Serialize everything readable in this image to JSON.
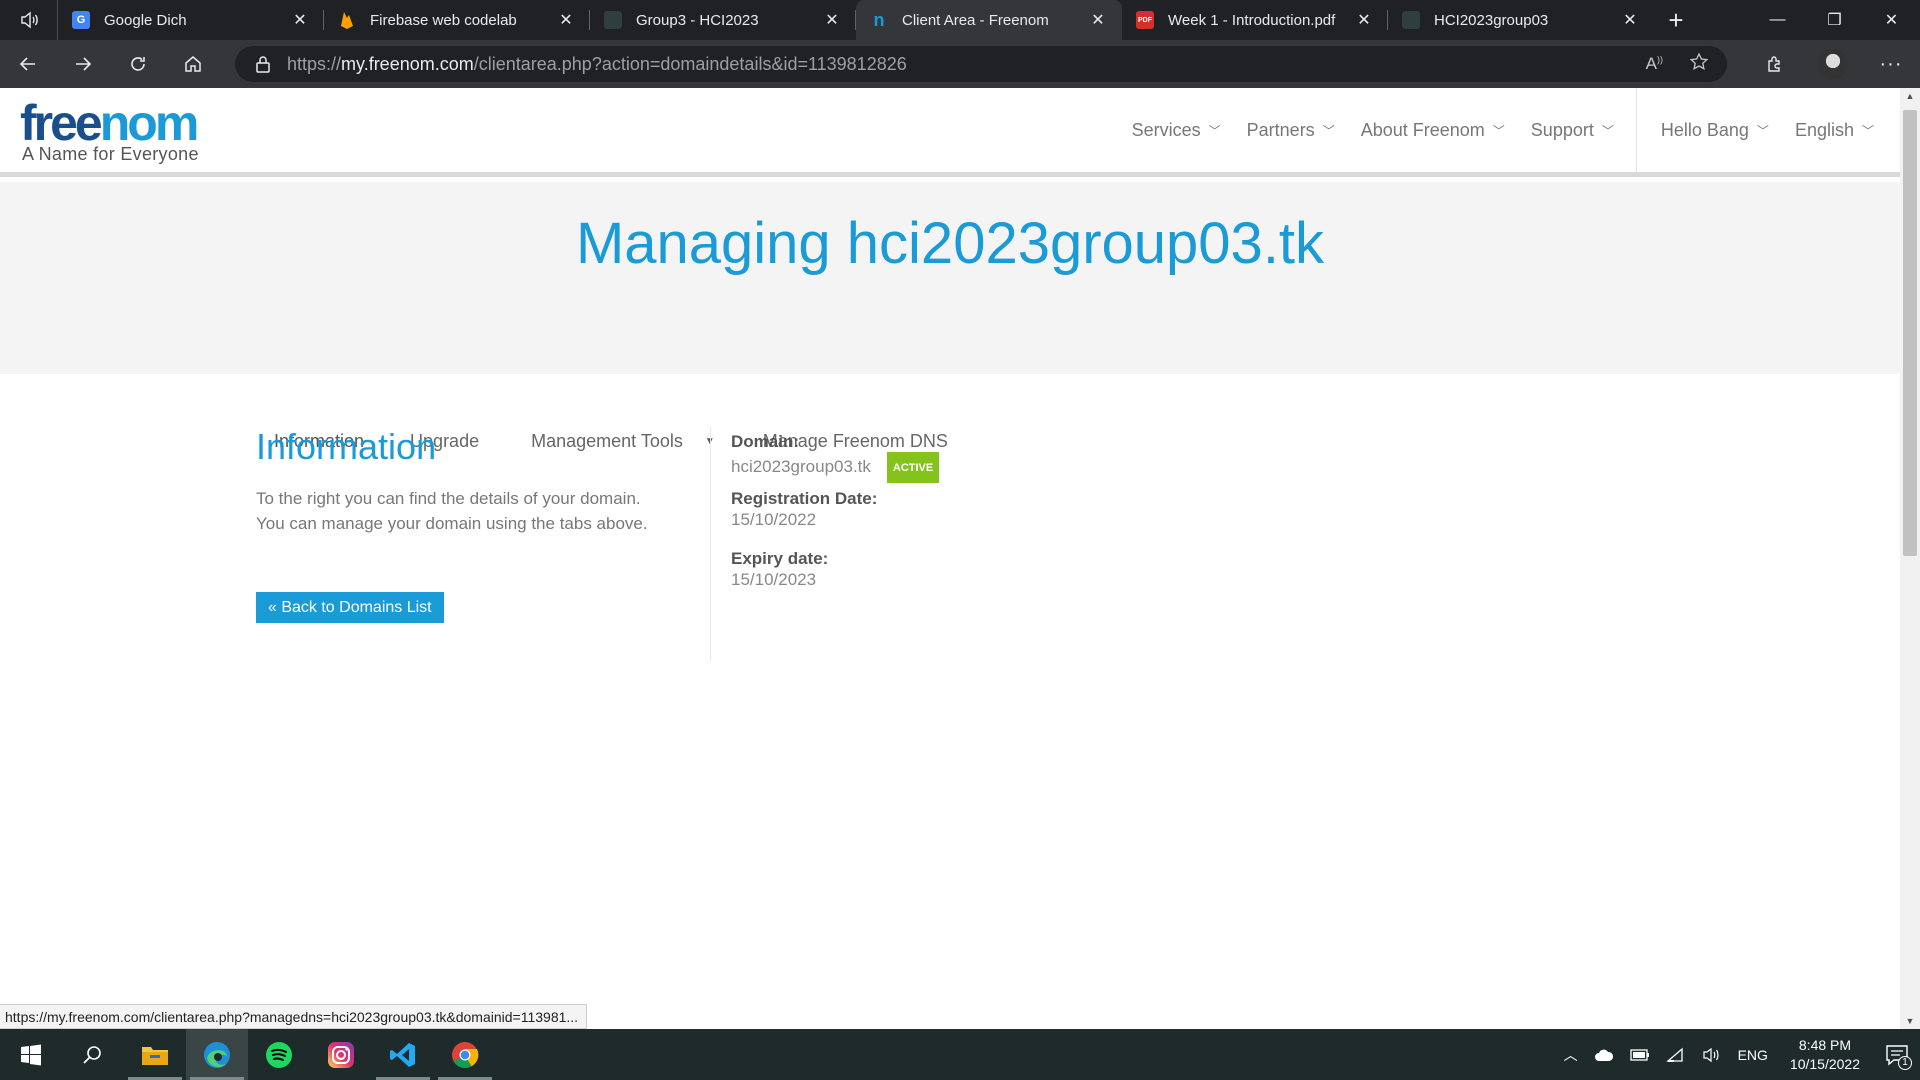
{
  "browser": {
    "tabs": [
      {
        "title": "Google Dich",
        "favicon": "google-translate-icon",
        "color": "#4285f4"
      },
      {
        "title": "Firebase web codelab",
        "favicon": "firebase-icon",
        "color": "#ffa000"
      },
      {
        "title": "Group3 - HCI2023",
        "favicon": "generic-page-icon",
        "color": "#2f3e3e"
      },
      {
        "title": "Client Area - Freenom",
        "favicon": "freenom-icon",
        "color": "#1a9bd7"
      },
      {
        "title": "Week 1 - Introduction.pdf",
        "favicon": "pdf-icon",
        "color": "#d32f2f"
      },
      {
        "title": "HCI2023group03",
        "favicon": "generic-page-icon",
        "color": "#2f3e3e"
      }
    ],
    "address": {
      "prefix": "https://",
      "host": "my.freenom.com",
      "path": "/clientarea.php?action=domaindetails&id=1139812826"
    }
  },
  "site": {
    "logo_part1": "free",
    "logo_part2": "nom",
    "tagline": "A Name for Everyone",
    "nav": [
      {
        "label": "Services"
      },
      {
        "label": "Partners"
      },
      {
        "label": "About Freenom"
      },
      {
        "label": "Support"
      },
      {
        "label": "Hello Bang"
      },
      {
        "label": "English"
      }
    ]
  },
  "main": {
    "title": "Managing hci2023group03.tk",
    "subtabs": [
      "Information",
      "Upgrade",
      "Management Tools",
      "Manage Freenom DNS"
    ],
    "info": {
      "heading": "Information",
      "line1": "To the right you can find the details of your domain.",
      "line2": "You can manage your domain using the tabs above.",
      "back_button": "« Back to Domains List"
    },
    "details": {
      "domain_label": "Domain:",
      "domain_value": "hci2023group03.tk",
      "status": "ACTIVE",
      "reg_label": "Registration Date:",
      "reg_value": "15/10/2022",
      "exp_label": "Expiry date:",
      "exp_value": "15/10/2023"
    }
  },
  "status_url": "https://my.freenom.com/clientarea.php?managedns=hci2023group03.tk&domainid=113981...",
  "taskbar": {
    "apps": [
      "windows-start-icon",
      "search-icon",
      "file-explorer-icon",
      "edge-icon",
      "spotify-icon",
      "instagram-icon",
      "vscode-icon",
      "chrome-icon"
    ],
    "language": "ENG",
    "time": "8:48 PM",
    "date": "10/15/2022",
    "notifications": "1"
  },
  "colors": {
    "accent": "#1a9bd7",
    "active_badge": "#84c21c",
    "logo_dark": "#1a4f8b"
  }
}
